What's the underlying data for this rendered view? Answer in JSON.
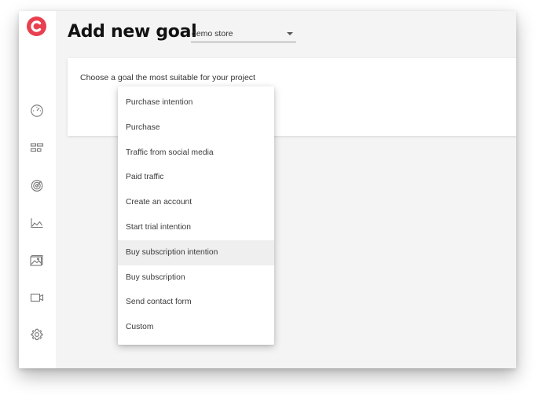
{
  "header": {
    "title": "Add new goal",
    "store_select": {
      "value": "demo store"
    }
  },
  "card": {
    "prompt": "Choose a goal the most suitable for your project"
  },
  "goal_dropdown": {
    "options": [
      {
        "label": "Purchase intention"
      },
      {
        "label": "Purchase"
      },
      {
        "label": "Traffic from social media"
      },
      {
        "label": "Paid traffic"
      },
      {
        "label": "Create an account"
      },
      {
        "label": "Start trial intention"
      },
      {
        "label": "Buy subscription intention"
      },
      {
        "label": "Buy subscription"
      },
      {
        "label": "Send contact form"
      },
      {
        "label": "Custom"
      }
    ],
    "highlighted_option": "Buy subscription intention"
  },
  "sidebar": {
    "logo_icon": "c-logo-icon",
    "nav_icons": [
      "dashboard-icon",
      "funnel-icon",
      "target-icon",
      "chart-icon",
      "heatmap-image-icon",
      "video-icon",
      "gear-icon"
    ]
  },
  "colors": {
    "brand": "#e8404f",
    "background": "#f4f4f4",
    "card": "#ffffff",
    "highlight": "#efefef"
  }
}
